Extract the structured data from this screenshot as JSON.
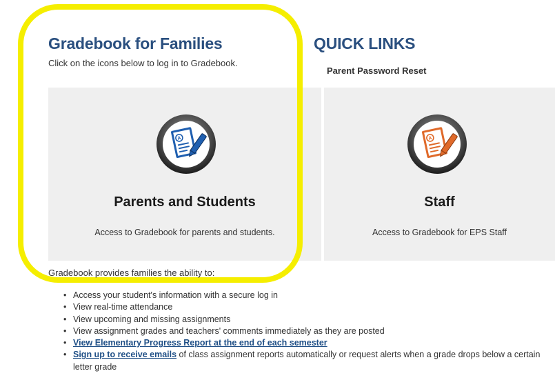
{
  "gradebook": {
    "title": "Gradebook for Families",
    "subtitle": "Click on the icons below to log in to Gradebook."
  },
  "quick_links": {
    "title": "QUICK LINKS",
    "items": [
      {
        "label": "Parent Password Reset"
      }
    ]
  },
  "cards": [
    {
      "title": "Parents and Students",
      "description": "Access to Gradebook for parents and students.",
      "icon": "gradebook-blue-icon",
      "color": "#2f6fc4"
    },
    {
      "title": "Staff",
      "description": "Access to Gradebook for EPS Staff",
      "icon": "gradebook-orange-icon",
      "color": "#e06a2a"
    }
  ],
  "highlight_color": "#f5ee00",
  "features": {
    "intro": "Gradebook provides families the ability to:",
    "items": [
      {
        "text": "Access your student's information with a secure log in"
      },
      {
        "text": "View real-time attendance"
      },
      {
        "text": "View upcoming and missing assignments"
      },
      {
        "text": "View assignment grades and teachers' comments immediately as they are posted"
      },
      {
        "link": "View Elementary Progress Report at the end of each semester"
      },
      {
        "link": "Sign up to receive emails",
        "text": " of class assignment reports automatically or request alerts when a grade drops below a certain letter grade"
      }
    ]
  }
}
